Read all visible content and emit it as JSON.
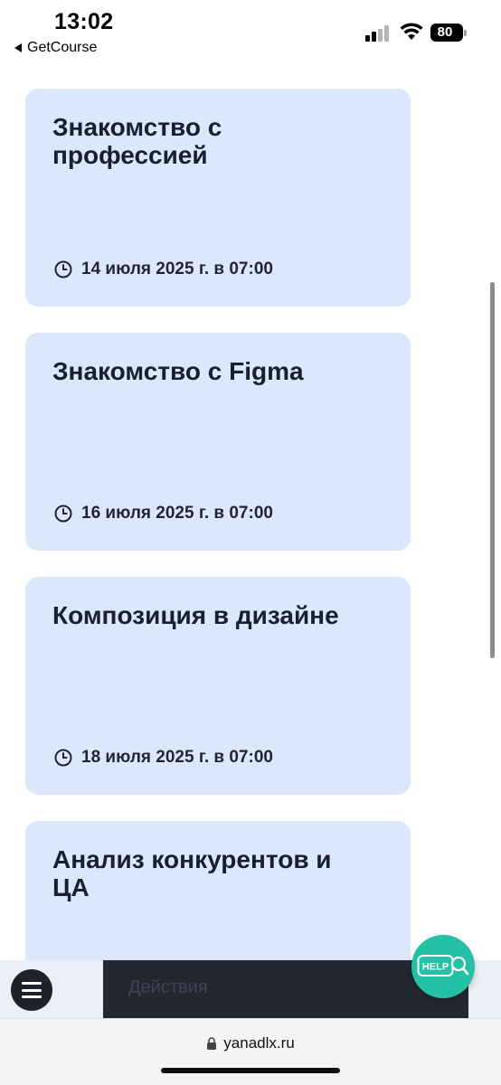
{
  "status_bar": {
    "time": "13:02",
    "back_label": "GetCourse",
    "battery_level": "80"
  },
  "lessons": [
    {
      "title": "Знакомство с профессией",
      "date": "14 июля 2025 г. в 07:00"
    },
    {
      "title": "Знакомство с Figma",
      "date": "16 июля 2025 г. в 07:00"
    },
    {
      "title": "Композиция в дизайне",
      "date": "18 июля 2025 г. в 07:00"
    },
    {
      "title": "Анализ конкурентов и ЦА",
      "date": ""
    }
  ],
  "bottom_bar": {
    "actions_label": "Действия",
    "help_label": "HELP"
  },
  "browser": {
    "url": "yanadlx.ru"
  },
  "colors": {
    "card_bg": "#dce7fb",
    "help_bg": "#25c0a6",
    "dark_bar": "#232731"
  }
}
